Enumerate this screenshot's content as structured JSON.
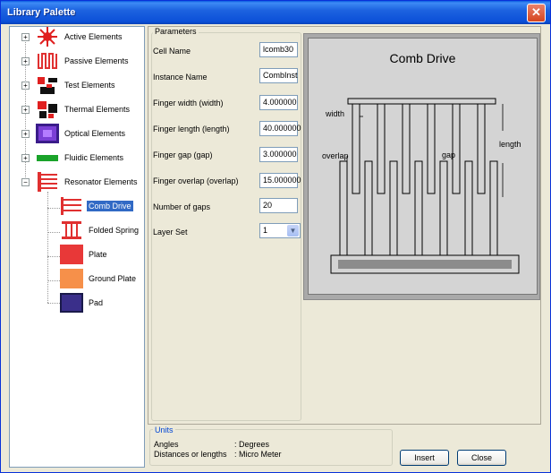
{
  "window": {
    "title": "Library Palette",
    "close_glyph": "✕"
  },
  "tree": {
    "items": [
      {
        "label": "Active Elements",
        "icon": "active-elements-icon",
        "expander": "+"
      },
      {
        "label": "Passive Elements",
        "icon": "passive-elements-icon",
        "expander": "+"
      },
      {
        "label": "Test Elements",
        "icon": "test-elements-icon",
        "expander": "+"
      },
      {
        "label": "Thermal Elements",
        "icon": "thermal-elements-icon",
        "expander": "+"
      },
      {
        "label": "Optical Elements",
        "icon": "optical-elements-icon",
        "expander": "+"
      },
      {
        "label": "Fluidic Elements",
        "icon": "fluidic-elements-icon",
        "expander": "+"
      },
      {
        "label": "Resonator Elements",
        "icon": "resonator-elements-icon",
        "expander": "−"
      }
    ],
    "children": [
      {
        "label": "Comb Drive",
        "icon": "comb-drive-icon",
        "selected": true
      },
      {
        "label": "Folded Spring",
        "icon": "folded-spring-icon",
        "selected": false
      },
      {
        "label": "Plate",
        "icon": "plate-icon",
        "selected": false
      },
      {
        "label": "Ground Plate",
        "icon": "ground-plate-icon",
        "selected": false
      },
      {
        "label": "Pad",
        "icon": "pad-icon",
        "selected": false
      }
    ]
  },
  "parameters": {
    "legend": "Parameters",
    "fields": [
      {
        "label": "Cell Name",
        "value": "lcomb30"
      },
      {
        "label": "Instance Name",
        "value": "CombInst"
      },
      {
        "label": "Finger width (width)",
        "value": "4.000000"
      },
      {
        "label": "Finger length (length)",
        "value": "40.000000"
      },
      {
        "label": "Finger gap (gap)",
        "value": "3.000000"
      },
      {
        "label": "Finger overlap (overlap)",
        "value": "15.000000"
      },
      {
        "label": "Number of gaps",
        "value": "20"
      }
    ],
    "layer_set": {
      "label": "Layer Set",
      "value": "1"
    }
  },
  "diagram": {
    "title": "Comb Drive",
    "labels": {
      "width": "width",
      "overlap": "overlap",
      "gap": "gap",
      "length": "length"
    }
  },
  "units": {
    "legend": "Units",
    "rows": [
      {
        "name": "Angles",
        "value": ": Degrees"
      },
      {
        "name": "Distances or lengths",
        "value": ": Micro Meter"
      }
    ]
  },
  "buttons": {
    "insert": "Insert",
    "close": "Close"
  },
  "colors": {
    "titlebar": "#0a5ae0",
    "selection": "#316ac5",
    "window_bg": "#ece9d8"
  }
}
